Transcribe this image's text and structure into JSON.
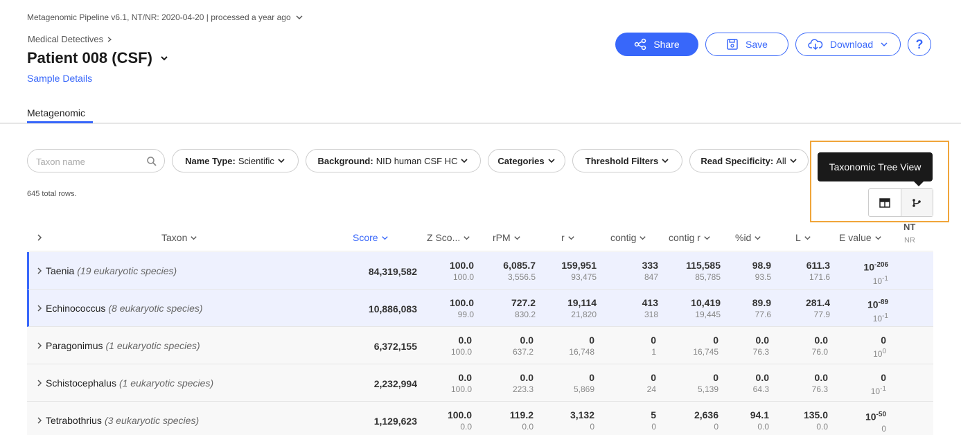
{
  "header": {
    "pipeline_text": "Metagenomic Pipeline v6.1, NT/NR: 2020-04-20 | processed a year ago",
    "breadcrumb": "Medical Detectives",
    "sample_title": "Patient 008 (CSF)",
    "sample_details_link": "Sample Details"
  },
  "actions": {
    "share": "Share",
    "save": "Save",
    "download": "Download",
    "help": "?"
  },
  "tabs": [
    {
      "label": "Metagenomic",
      "active": true
    }
  ],
  "filters": {
    "search_placeholder": "Taxon name",
    "name_type": {
      "label": "Name Type:",
      "value": "Scientific"
    },
    "background": {
      "label": "Background:",
      "value": "NID human CSF HC"
    },
    "categories": "Categories",
    "threshold": "Threshold Filters",
    "read_specificity": {
      "label": "Read Specificity:",
      "value": "All"
    }
  },
  "total_rows": "645 total rows.",
  "tooltip": "Taxonomic Tree View",
  "table": {
    "columns": [
      "Taxon",
      "Score",
      "Z Sco...",
      "rPM",
      "r",
      "contig",
      "contig r",
      "%id",
      "L",
      "E value"
    ],
    "nt_label": "NT",
    "nr_label": "NR",
    "rows": [
      {
        "name": "Taenia",
        "desc": "(19 eukaryotic species)",
        "score": "84,319,582",
        "selected": true,
        "z": [
          "100.0",
          "100.0"
        ],
        "rpm": [
          "6,085.7",
          "3,556.5"
        ],
        "r": [
          "159,951",
          "93,475"
        ],
        "contig": [
          "333",
          "847"
        ],
        "contig_r": [
          "115,585",
          "85,785"
        ],
        "pid": [
          "98.9",
          "93.5"
        ],
        "l": [
          "611.3",
          "171.6"
        ],
        "e_nt": "-206",
        "e_nr": "-1"
      },
      {
        "name": "Echinococcus",
        "desc": "(8 eukaryotic species)",
        "score": "10,886,083",
        "selected": true,
        "z": [
          "100.0",
          "99.0"
        ],
        "rpm": [
          "727.2",
          "830.2"
        ],
        "r": [
          "19,114",
          "21,820"
        ],
        "contig": [
          "413",
          "318"
        ],
        "contig_r": [
          "10,419",
          "19,445"
        ],
        "pid": [
          "89.9",
          "77.6"
        ],
        "l": [
          "281.4",
          "77.9"
        ],
        "e_nt": "-89",
        "e_nr": "-1"
      },
      {
        "name": "Paragonimus",
        "desc": "(1 eukaryotic species)",
        "score": "6,372,155",
        "selected": false,
        "z": [
          "0.0",
          "100.0"
        ],
        "rpm": [
          "0.0",
          "637.2"
        ],
        "r": [
          "0",
          "16,748"
        ],
        "contig": [
          "0",
          "1"
        ],
        "contig_r": [
          "0",
          "16,745"
        ],
        "pid": [
          "0.0",
          "76.3"
        ],
        "l": [
          "0.0",
          "76.0"
        ],
        "e_nt": "",
        "e_nr": "0"
      },
      {
        "name": "Schistocephalus",
        "desc": "(1 eukaryotic species)",
        "score": "2,232,994",
        "selected": false,
        "z": [
          "0.0",
          "100.0"
        ],
        "rpm": [
          "0.0",
          "223.3"
        ],
        "r": [
          "0",
          "5,869"
        ],
        "contig": [
          "0",
          "24"
        ],
        "contig_r": [
          "0",
          "5,139"
        ],
        "pid": [
          "0.0",
          "64.3"
        ],
        "l": [
          "0.0",
          "76.3"
        ],
        "e_nt": "",
        "e_nr": "-1"
      },
      {
        "name": "Tetrabothrius",
        "desc": "(3 eukaryotic species)",
        "score": "1,129,623",
        "selected": false,
        "z": [
          "100.0",
          "0.0"
        ],
        "rpm": [
          "119.2",
          "0.0"
        ],
        "r": [
          "3,132",
          "0"
        ],
        "contig": [
          "5",
          "0"
        ],
        "contig_r": [
          "2,636",
          "0"
        ],
        "pid": [
          "94.1",
          "0.0"
        ],
        "l": [
          "135.0",
          "0.0"
        ],
        "e_nt": "-50",
        "e_nr": ""
      }
    ]
  },
  "colors": {
    "accent": "#3867fa",
    "highlight_border": "#f0a53a",
    "tooltip_bg": "#1a1a1a"
  }
}
